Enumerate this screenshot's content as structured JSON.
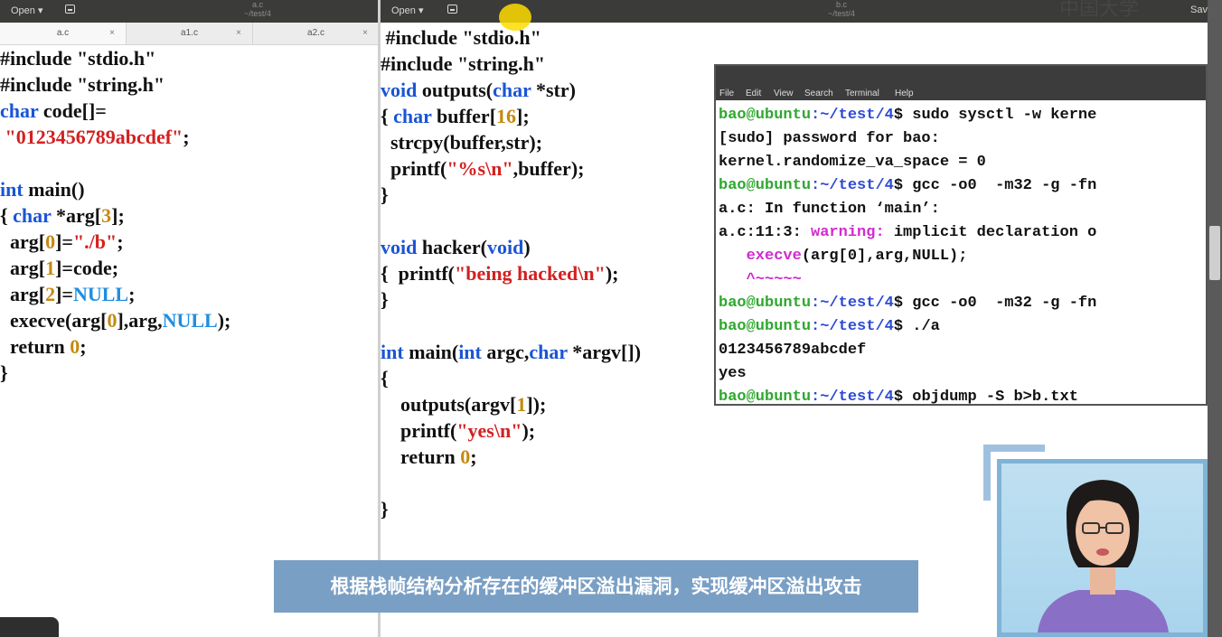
{
  "left_editor": {
    "open_label": "Open ▾",
    "title": "a.c",
    "subtitle": "~/test/4",
    "tabs": [
      {
        "label": "a.c"
      },
      {
        "label": "a1.c"
      },
      {
        "label": "a2.c"
      }
    ],
    "tab_close": "×",
    "code": {
      "l1": "#include \"stdio.h\"",
      "l2": "#include \"string.h\"",
      "l3a": "char",
      "l3b": " code[]=",
      "l4a": " \"0123456789abcdef\"",
      "l4b": ";",
      "l6a": "int",
      "l6b": " main()",
      "l7a": "{ ",
      "l7b": "char",
      "l7c": " *arg[",
      "l7d": "3",
      "l7e": "];",
      "l8a": "  arg[",
      "l8b": "0",
      "l8c": "]=",
      "l8d": "\"./b\"",
      "l8e": ";",
      "l9a": "  arg[",
      "l9b": "1",
      "l9c": "]=code;",
      "l10a": "  arg[",
      "l10b": "2",
      "l10c": "]=",
      "l10d": "NULL",
      "l10e": ";",
      "l11a": "  execve(arg[",
      "l11b": "0",
      "l11c": "],arg,",
      "l11d": "NULL",
      "l11e": ");",
      "l12a": "  return ",
      "l12b": "0",
      "l12c": ";",
      "l13": "}"
    }
  },
  "right_editor": {
    "open_label": "Open ▾",
    "title": "b.c",
    "subtitle": "~/test/4",
    "save_label": "Sav",
    "code": {
      "l1": " #include \"stdio.h\"",
      "l2": "#include \"string.h\"",
      "l3a": "void",
      "l3b": " outputs(",
      "l3c": "char",
      "l3d": " *str)",
      "l4a": "{ ",
      "l4b": "char",
      "l4c": " buffer[",
      "l4d": "16",
      "l4e": "];",
      "l5": "  strcpy(buffer,str);",
      "l6a": "  printf(",
      "l6b": "\"%s\\n\"",
      "l6c": ",buffer);",
      "l7": "}",
      "l9a": "void",
      "l9b": " hacker(",
      "l9c": "void",
      "l9d": ")",
      "l10a": "{  printf(",
      "l10b": "\"being hacked\\n\"",
      "l10c": ");",
      "l11": "}",
      "l13a": "int",
      "l13b": " main(",
      "l13c": "int",
      "l13d": " argc,",
      "l13e": "char",
      "l13f": " *argv[])",
      "l14": "{",
      "l15a": "    outputs(argv[",
      "l15b": "1",
      "l15c": "]);",
      "l16a": "    printf(",
      "l16b": "\"yes\\n\"",
      "l16c": ");",
      "l17a": "    return ",
      "l17b": "0",
      "l17c": ";",
      "l19": "}"
    }
  },
  "terminal": {
    "menu": [
      "File",
      "Edit",
      "View",
      "Search",
      "Terminal",
      "Help"
    ],
    "prompt_user": "bao@ubuntu",
    "prompt_path": ":~/test/4",
    "prompt_sym": "$ ",
    "cmd1": "sudo sysctl -w kerne",
    "out1": "[sudo] password for bao:",
    "out2": "kernel.randomize_va_space = 0",
    "cmd2": "gcc -o0  -m32 -g -fn",
    "out3": "a.c: In function ‘main’:",
    "out4a": "a.c:11:3: ",
    "out4b": "warning:",
    "out4c": " implicit declaration o",
    "out5a": "   ",
    "out5b": "execve",
    "out5c": "(arg[0],arg,NULL);",
    "out6": "   ^~~~~~",
    "cmd3": "gcc -o0  -m32 -g -fn",
    "cmd4": "./a",
    "out7": "0123456789abcdef",
    "out8": "yes",
    "cmd5": "objdump -S b>b.txt"
  },
  "subtitle_text": "根据栈帧结构分析存在的缓冲区溢出漏洞，实现缓冲区溢出攻击",
  "watermark": "中国大学",
  "icons": [
    "save-icon",
    "cursor-highlight",
    "presenter-video"
  ]
}
